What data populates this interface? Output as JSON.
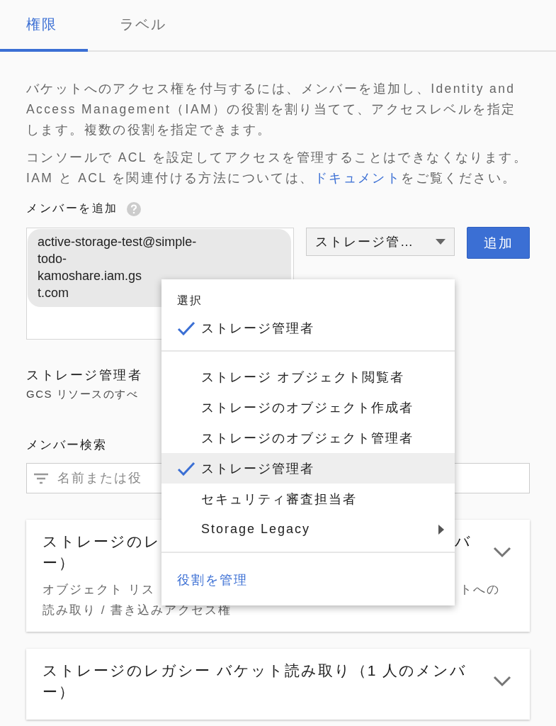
{
  "tabs": [
    {
      "label": "権限",
      "selected": true
    },
    {
      "label": "ラベル",
      "selected": false
    }
  ],
  "intro": {
    "paragraph": "バケットへのアクセス権を付与するには、メンバーを追加し、Identity and Access Management（IAM）の役割を割り当てて、アクセスレベルを指定します。複数の役割を指定できます。",
    "notice_before": "コンソールで ACL を設定してアクセスを管理することはできなくなります。IAM と ACL を関連付ける方法については、",
    "notice_link": "ドキュメント",
    "notice_after": "をご覧ください。"
  },
  "add_member": {
    "label": "メンバーを追加",
    "chip_lines": [
      "active-storage-test@simple-",
      "todo-",
      "kamoshare.iam.gs",
      "t.com"
    ],
    "role_select": "ストレージ管…",
    "button": "追加"
  },
  "role_info": {
    "title": "ストレージ管理者",
    "description": "GCS リソースのすべ"
  },
  "member_search": {
    "label": "メンバー検索",
    "placeholder": "名前または役"
  },
  "cards": [
    {
      "title_left": "ストレージのレ",
      "title_right": "バ",
      "title_line2": "ー）",
      "desc_left": "オブジェクト リス",
      "desc_right": "トへの",
      "desc_line2": "読み取り / 書き込みアクセス権",
      "expanded": false
    },
    {
      "title_left": "ストレージのレガシー バケット読み取り（1 人のメンバー）",
      "expanded": false
    }
  ],
  "role_menu": {
    "header": "選択",
    "current": {
      "label": "ストレージ管理者",
      "checked": true
    },
    "items": [
      {
        "label": "ストレージ オブジェクト閲覧者",
        "checked": false,
        "selected": false,
        "submenu": false
      },
      {
        "label": "ストレージのオブジェクト作成者",
        "checked": false,
        "selected": false,
        "submenu": false
      },
      {
        "label": "ストレージのオブジェクト管理者",
        "checked": false,
        "selected": false,
        "submenu": false
      },
      {
        "label": "ストレージ管理者",
        "checked": true,
        "selected": true,
        "submenu": false
      },
      {
        "label": "セキュリティ審査担当者",
        "checked": false,
        "selected": false,
        "submenu": false
      },
      {
        "label": "Storage Legacy",
        "checked": false,
        "selected": false,
        "submenu": true
      }
    ],
    "footer_link": "役割を管理"
  }
}
